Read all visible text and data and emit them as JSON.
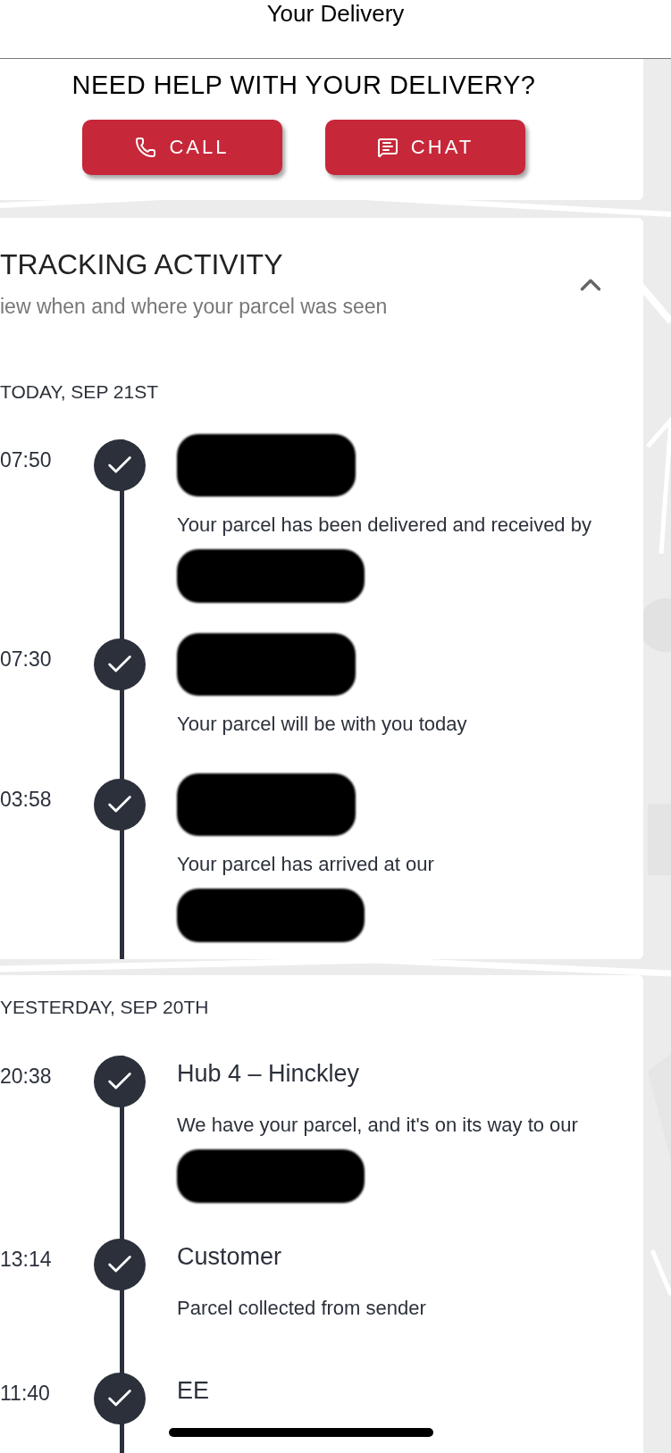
{
  "header": {
    "title": "Your Delivery"
  },
  "help": {
    "title": "NEED HELP WITH YOUR DELIVERY?",
    "buttons": [
      {
        "kind": "call",
        "label": "CALL"
      },
      {
        "kind": "chat",
        "label": "CHAT"
      }
    ]
  },
  "tracking": {
    "title": "TRACKING ACTIVITY",
    "subtitle": "iew when and where your parcel was seen",
    "expanded": true,
    "sections": [
      {
        "date": "TODAY, SEP 21ST",
        "events": [
          {
            "time": "07:50",
            "title_redacted": true,
            "description": "Your parcel has been delivered and received by",
            "description_redacted": true
          },
          {
            "time": "07:30",
            "title_redacted": true,
            "description": "Your parcel will be with you today",
            "description_redacted": false
          },
          {
            "time": "03:58",
            "title_redacted": true,
            "description": "Your parcel has arrived at our",
            "description_redacted": true
          }
        ]
      },
      {
        "date": "YESTERDAY, SEP 20TH",
        "events": [
          {
            "time": "20:38",
            "title": "Hub 4 – Hinckley",
            "title_redacted": false,
            "description": "We have your parcel, and it's on its way to our",
            "description_redacted": true
          },
          {
            "time": "13:14",
            "title": "Customer",
            "title_redacted": false,
            "description": "Parcel collected from sender",
            "description_redacted": false
          },
          {
            "time": "11:40",
            "title": "EE",
            "title_redacted": false,
            "description_redacted": false
          }
        ]
      }
    ]
  }
}
